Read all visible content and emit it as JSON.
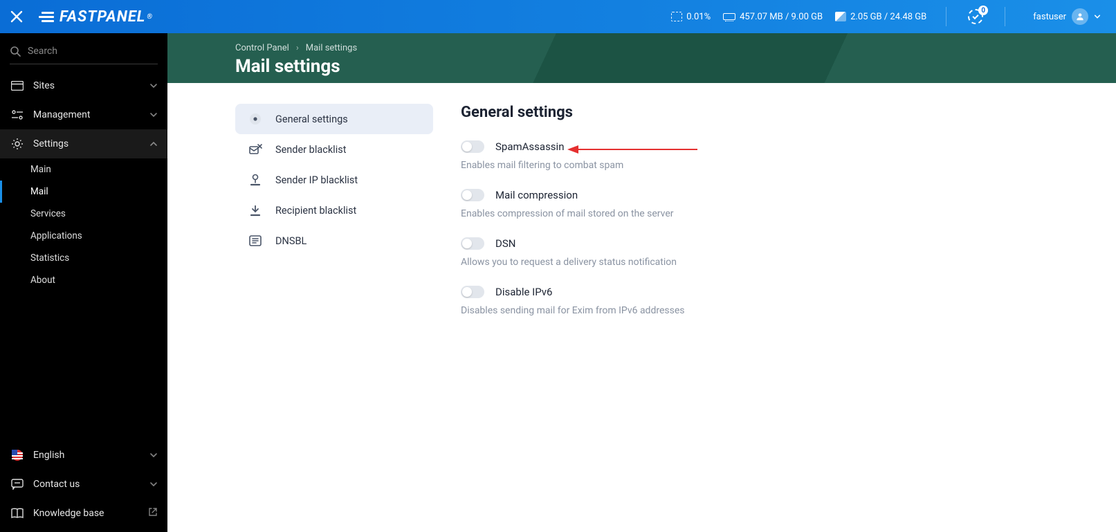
{
  "topbar": {
    "logo": "FASTPANEL",
    "cpu": "0.01%",
    "ram": "457.07 MB / 9.00 GB",
    "disk": "2.05 GB / 24.48 GB",
    "notif_count": "0",
    "username": "fastuser"
  },
  "sidebar": {
    "search_placeholder": "Search",
    "items": {
      "sites": "Sites",
      "management": "Management",
      "settings": "Settings"
    },
    "sub": {
      "main": "Main",
      "mail": "Mail",
      "services": "Services",
      "applications": "Applications",
      "statistics": "Statistics",
      "about": "About"
    },
    "bottom": {
      "lang": "English",
      "contact": "Contact us",
      "kb": "Knowledge base"
    }
  },
  "breadcrumb": {
    "root": "Control Panel",
    "current": "Mail settings"
  },
  "page_title": "Mail settings",
  "tabs": {
    "general": "General settings",
    "sender_bl": "Sender blacklist",
    "sender_ip_bl": "Sender IP blacklist",
    "recipient_bl": "Recipient blacklist",
    "dnsbl": "DNSBL"
  },
  "pane": {
    "title": "General settings",
    "spamassassin": {
      "label": "SpamAssassin",
      "desc": "Enables mail filtering to combat spam"
    },
    "compression": {
      "label": "Mail compression",
      "desc": "Enables compression of mail stored on the server"
    },
    "dsn": {
      "label": "DSN",
      "desc": "Allows you to request a delivery status notification"
    },
    "ipv6": {
      "label": "Disable IPv6",
      "desc": "Disables sending mail for Exim from IPv6 addresses"
    }
  }
}
